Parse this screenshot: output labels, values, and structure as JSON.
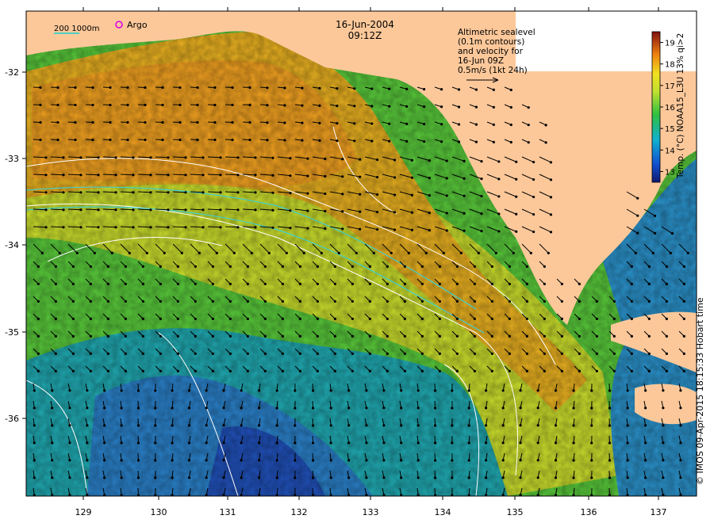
{
  "map": {
    "date": "16-Jun-2004",
    "time": "09:12Z",
    "legend": {
      "isobath_label": "200  1000m",
      "argo_label": "Argo",
      "isobath_color": "#4fd0c0",
      "argo_color": "#e000e0"
    },
    "annotation": {
      "lines": [
        "Altimetric sealevel",
        "(0.1m contours)",
        "and velocity for",
        "16-Jun 09Z",
        "0.5m/s (1kt 24h)"
      ]
    },
    "colorbar": {
      "label": "Temp. (°C) NOAA15_L3U 13% qi>2",
      "min": 13,
      "max": 19,
      "ticks": [
        "13",
        "14",
        "15",
        "16",
        "17",
        "18",
        "19"
      ]
    },
    "axes": {
      "lon_ticks": [
        "129",
        "130",
        "131",
        "132",
        "133",
        "134",
        "135",
        "136",
        "137"
      ],
      "lat_ticks": [
        "-32",
        "-33",
        "-34",
        "-35",
        "-36"
      ]
    },
    "credit": "© IMOS 09-Apr-2015 18:15:33 Hobart time",
    "colors": {
      "land": "#fcc89a",
      "warm": "#f0a020",
      "mid": "#c8e030",
      "cool": "#40c040",
      "cold": "#1060c0",
      "contour": "#ffffff",
      "vector": "#000000"
    }
  }
}
